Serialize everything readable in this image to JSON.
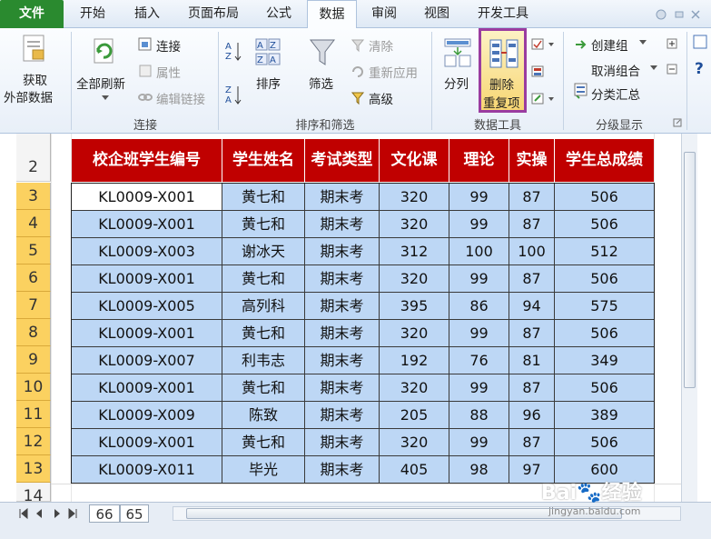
{
  "ribbon_tabs": [
    "文件",
    "开始",
    "插入",
    "页面布局",
    "公式",
    "数据",
    "审阅",
    "视图",
    "开发工具"
  ],
  "active_tab": "数据",
  "groups": {
    "connections": {
      "label": "连接",
      "get_external": [
        "获取",
        "外部数据"
      ],
      "refresh_all": "全部刷新",
      "connections": "连接",
      "properties": "属性",
      "edit_links": "编辑链接"
    },
    "sort_filter": {
      "label": "排序和筛选",
      "sort": "排序",
      "filter": "筛选",
      "clear": "清除",
      "reapply": "重新应用",
      "advanced": "高级"
    },
    "data_tools": {
      "label": "数据工具",
      "text_to_columns": "分列",
      "remove_duplicates": [
        "删除",
        "重复项"
      ]
    },
    "outline": {
      "label": "分级显示",
      "group": "创建组",
      "ungroup": "取消组合",
      "subtotal": "分类汇总"
    }
  },
  "row_numbers": [
    "2",
    "3",
    "4",
    "5",
    "6",
    "7",
    "8",
    "9",
    "10",
    "11",
    "12",
    "13",
    "14"
  ],
  "table": {
    "headers": [
      "校企班学生编号",
      "学生姓名",
      "考试类型",
      "文化课",
      "理论",
      "实操",
      "学生总成绩"
    ],
    "rows": [
      [
        "KL0009-X001",
        "黄七和",
        "期末考",
        "320",
        "99",
        "87",
        "506"
      ],
      [
        "KL0009-X001",
        "黄七和",
        "期末考",
        "320",
        "99",
        "87",
        "506"
      ],
      [
        "KL0009-X003",
        "谢冰天",
        "期末考",
        "312",
        "100",
        "100",
        "512"
      ],
      [
        "KL0009-X001",
        "黄七和",
        "期末考",
        "320",
        "99",
        "87",
        "506"
      ],
      [
        "KL0009-X005",
        "高列科",
        "期末考",
        "395",
        "86",
        "94",
        "575"
      ],
      [
        "KL0009-X001",
        "黄七和",
        "期末考",
        "320",
        "99",
        "87",
        "506"
      ],
      [
        "KL0009-X007",
        "利韦志",
        "期末考",
        "192",
        "76",
        "81",
        "349"
      ],
      [
        "KL0009-X001",
        "黄七和",
        "期末考",
        "320",
        "99",
        "87",
        "506"
      ],
      [
        "KL0009-X009",
        "陈致",
        "期末考",
        "205",
        "88",
        "96",
        "389"
      ],
      [
        "KL0009-X001",
        "黄七和",
        "期末考",
        "320",
        "99",
        "87",
        "506"
      ],
      [
        "KL0009-X011",
        "毕光",
        "期末考",
        "405",
        "98",
        "97",
        "600"
      ]
    ]
  },
  "sheet_tabs": [
    "66",
    "65"
  ],
  "watermark": {
    "brand": "Bai",
    "brand2": "经验",
    "url": "jingyan.baidu.com"
  },
  "colors": {
    "header_bg": "#c00000",
    "cell_bg": "#bdd7f5",
    "row_header": "#fbd160",
    "highlight": "#9a3ca0",
    "file_tab": "#2a8a2f"
  }
}
